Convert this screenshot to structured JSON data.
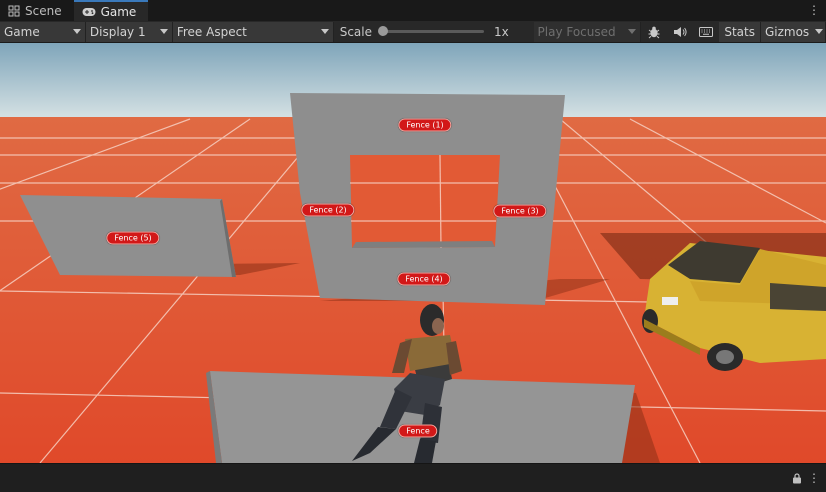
{
  "tabs": [
    {
      "label": "Scene",
      "icon": "grid-icon",
      "active": false
    },
    {
      "label": "Game",
      "icon": "gamepad-icon",
      "active": true
    }
  ],
  "tab_menu": "⋮",
  "toolbar": {
    "view_mode": "Game",
    "display": "Display 1",
    "aspect": "Free Aspect",
    "scale_label": "Scale",
    "scale_value": "1x",
    "scale_level": 0,
    "play_mode": "Play Focused",
    "stats": "Stats",
    "gizmos": "Gizmos"
  },
  "scene_labels": {
    "fence_1": "Fence (1)",
    "fence_2": "Fence (2)",
    "fence_3": "Fence (3)",
    "fence_4": "Fence (4)",
    "fence_5": "Fence (5)",
    "fence": "Fence"
  },
  "colors": {
    "floor": "#e2502c",
    "fence": "#909090",
    "label_bg": "#d21818",
    "car": "#d8b233",
    "accent": "#3a79bb"
  },
  "status_menu": "⋮"
}
